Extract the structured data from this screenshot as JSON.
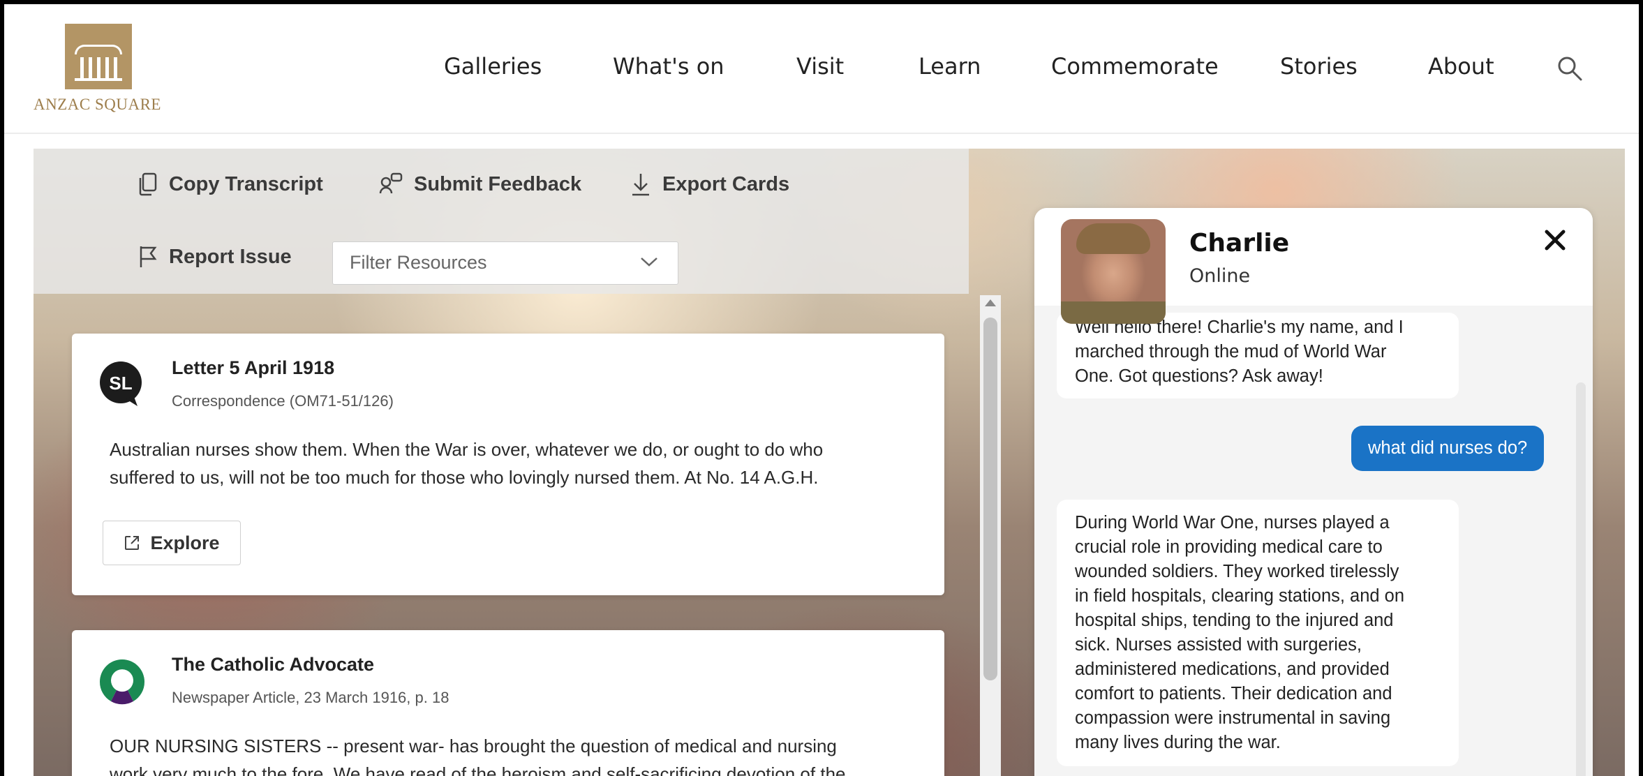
{
  "logo": {
    "text": "ANZAC SQUARE"
  },
  "nav": {
    "items": [
      "Galleries",
      "What's on",
      "Visit",
      "Learn",
      "Commemorate",
      "Stories",
      "About"
    ]
  },
  "toolbar": {
    "copy_transcript": "Copy Transcript",
    "submit_feedback": "Submit Feedback",
    "export_cards": "Export Cards",
    "report_issue": "Report Issue",
    "filter_placeholder": "Filter Resources"
  },
  "resources": [
    {
      "badge": "SL",
      "title": "Letter 5 April 1918",
      "subtitle": "Correspondence (OM71-51/126)",
      "body_line1": "Australian nurses show them. When the War is over, whatever we do, or ought to do who",
      "body_line2": "suffered to us, will not be too much for those who lovingly nursed them. At No. 14 A.G.H.",
      "button": "Explore"
    },
    {
      "title": "The Catholic Advocate",
      "subtitle": "Newspaper Article, 23 March 1916, p. 18",
      "body_line1": "OUR NURSING SISTERS -- present war- has brought the question of medical and nursing",
      "body_line2": "work very much to the fore. We have read of the heroism and self-sacrificing devotion of the"
    }
  ],
  "chat": {
    "name": "Charlie",
    "status": "Online",
    "messages": [
      {
        "from": "bot",
        "lines": [
          "Well hello there! Charlie's my name, and I",
          "marched through the mud of World War",
          "One. Got questions? Ask away!"
        ]
      },
      {
        "from": "user",
        "text": "what did nurses do?"
      },
      {
        "from": "bot",
        "lines": [
          "During World War One, nurses played a",
          "crucial role in providing medical care to",
          "wounded soldiers. They worked tirelessly",
          "in field hospitals, clearing stations, and on",
          "hospital ships, tending to the injured and",
          "sick. Nurses assisted with surgeries,",
          "administered medications, and provided",
          "comfort to patients. Their dedication and",
          "compassion were instrumental in saving",
          "many lives during the war."
        ]
      }
    ]
  },
  "colors": {
    "brand_gold": "#b39565",
    "user_bubble": "#1a73c6"
  }
}
